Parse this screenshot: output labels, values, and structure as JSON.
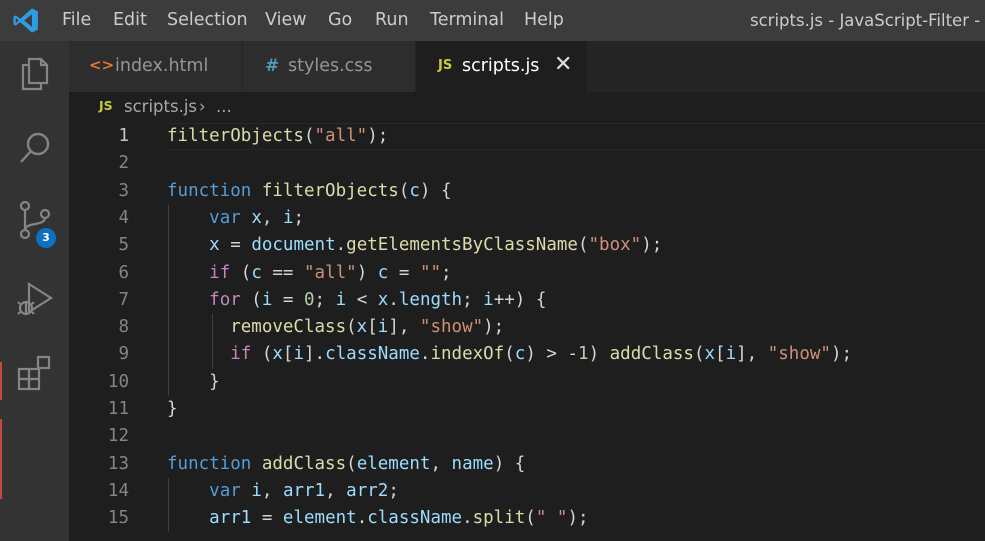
{
  "menu": [
    "File",
    "Edit",
    "Selection",
    "View",
    "Go",
    "Run",
    "Terminal",
    "Help"
  ],
  "window_title": "scripts.js - JavaScript-Filter - Vis",
  "activity_bar": {
    "items": [
      "explorer-icon",
      "search-icon",
      "source-control-icon",
      "run-debug-icon",
      "extensions-icon"
    ],
    "source_control_badge": "3"
  },
  "tabs": [
    {
      "icon_text": "<>",
      "icon_color": "#e37933",
      "label": "index.html",
      "active": false
    },
    {
      "icon_text": "#",
      "icon_color": "#519aba",
      "label": "styles.css",
      "active": false
    },
    {
      "icon_text": "JS",
      "icon_color": "#cbcb41",
      "label": "scripts.js",
      "active": true,
      "close": "✕"
    }
  ],
  "breadcrumb": {
    "icon_text": "JS",
    "file": "scripts.js",
    "separator": "›",
    "rest": "..."
  },
  "colors": {
    "keyword": "#569cd6",
    "control": "#c586c0",
    "function": "#dcdcaa",
    "variable": "#9cdcfe",
    "string": "#ce9178",
    "number": "#b5cea8",
    "plain": "#d4d4d4",
    "line_number": "#858585"
  },
  "code_lines": [
    {
      "n": "1",
      "tokens": [
        [
          "fn",
          "filterObjects"
        ],
        [
          "p",
          "("
        ],
        [
          "str",
          "\"all\""
        ],
        [
          "p",
          ");"
        ]
      ]
    },
    {
      "n": "2",
      "tokens": []
    },
    {
      "n": "3",
      "tokens": [
        [
          "kw",
          "function"
        ],
        [
          "p",
          " "
        ],
        [
          "fn",
          "filterObjects"
        ],
        [
          "p",
          "("
        ],
        [
          "var",
          "c"
        ],
        [
          "p",
          ") {"
        ]
      ]
    },
    {
      "n": "4",
      "tokens": [
        [
          "p",
          "    "
        ],
        [
          "kw",
          "var"
        ],
        [
          "p",
          " "
        ],
        [
          "var",
          "x"
        ],
        [
          "p",
          ", "
        ],
        [
          "var",
          "i"
        ],
        [
          "p",
          ";"
        ]
      ]
    },
    {
      "n": "5",
      "tokens": [
        [
          "p",
          "    "
        ],
        [
          "var",
          "x"
        ],
        [
          "p",
          " = "
        ],
        [
          "var",
          "document"
        ],
        [
          "p",
          "."
        ],
        [
          "fn",
          "getElementsByClassName"
        ],
        [
          "p",
          "("
        ],
        [
          "str",
          "\"box\""
        ],
        [
          "p",
          ");"
        ]
      ]
    },
    {
      "n": "6",
      "tokens": [
        [
          "p",
          "    "
        ],
        [
          "ctl",
          "if"
        ],
        [
          "p",
          " ("
        ],
        [
          "var",
          "c"
        ],
        [
          "p",
          " == "
        ],
        [
          "str",
          "\"all\""
        ],
        [
          "p",
          ") "
        ],
        [
          "var",
          "c"
        ],
        [
          "p",
          " = "
        ],
        [
          "str",
          "\"\""
        ],
        [
          "p",
          ";"
        ]
      ]
    },
    {
      "n": "7",
      "tokens": [
        [
          "p",
          "    "
        ],
        [
          "ctl",
          "for"
        ],
        [
          "p",
          " ("
        ],
        [
          "var",
          "i"
        ],
        [
          "p",
          " = "
        ],
        [
          "num",
          "0"
        ],
        [
          "p",
          "; "
        ],
        [
          "var",
          "i"
        ],
        [
          "p",
          " < "
        ],
        [
          "var",
          "x"
        ],
        [
          "p",
          "."
        ],
        [
          "var",
          "length"
        ],
        [
          "p",
          "; "
        ],
        [
          "var",
          "i"
        ],
        [
          "p",
          "++) {"
        ]
      ]
    },
    {
      "n": "8",
      "tokens": [
        [
          "p",
          "      "
        ],
        [
          "fn",
          "removeClass"
        ],
        [
          "p",
          "("
        ],
        [
          "var",
          "x"
        ],
        [
          "p",
          "["
        ],
        [
          "var",
          "i"
        ],
        [
          "p",
          "], "
        ],
        [
          "str",
          "\"show\""
        ],
        [
          "p",
          ");"
        ]
      ]
    },
    {
      "n": "9",
      "tokens": [
        [
          "p",
          "      "
        ],
        [
          "ctl",
          "if"
        ],
        [
          "p",
          " ("
        ],
        [
          "var",
          "x"
        ],
        [
          "p",
          "["
        ],
        [
          "var",
          "i"
        ],
        [
          "p",
          "]."
        ],
        [
          "var",
          "className"
        ],
        [
          "p",
          "."
        ],
        [
          "fn",
          "indexOf"
        ],
        [
          "p",
          "("
        ],
        [
          "var",
          "c"
        ],
        [
          "p",
          ") > -"
        ],
        [
          "num",
          "1"
        ],
        [
          "p",
          ") "
        ],
        [
          "fn",
          "addClass"
        ],
        [
          "p",
          "("
        ],
        [
          "var",
          "x"
        ],
        [
          "p",
          "["
        ],
        [
          "var",
          "i"
        ],
        [
          "p",
          "], "
        ],
        [
          "str",
          "\"show\""
        ],
        [
          "p",
          ");"
        ]
      ]
    },
    {
      "n": "10",
      "tokens": [
        [
          "p",
          "    }"
        ]
      ]
    },
    {
      "n": "11",
      "tokens": [
        [
          "p",
          "}"
        ]
      ]
    },
    {
      "n": "12",
      "tokens": []
    },
    {
      "n": "13",
      "tokens": [
        [
          "kw",
          "function"
        ],
        [
          "p",
          " "
        ],
        [
          "fn",
          "addClass"
        ],
        [
          "p",
          "("
        ],
        [
          "var",
          "element"
        ],
        [
          "p",
          ", "
        ],
        [
          "var",
          "name"
        ],
        [
          "p",
          ") {"
        ]
      ]
    },
    {
      "n": "14",
      "tokens": [
        [
          "p",
          "    "
        ],
        [
          "kw",
          "var"
        ],
        [
          "p",
          " "
        ],
        [
          "var",
          "i"
        ],
        [
          "p",
          ", "
        ],
        [
          "var",
          "arr1"
        ],
        [
          "p",
          ", "
        ],
        [
          "var",
          "arr2"
        ],
        [
          "p",
          ";"
        ]
      ]
    },
    {
      "n": "15",
      "tokens": [
        [
          "p",
          "    "
        ],
        [
          "var",
          "arr1"
        ],
        [
          "p",
          " = "
        ],
        [
          "var",
          "element"
        ],
        [
          "p",
          "."
        ],
        [
          "var",
          "className"
        ],
        [
          "p",
          "."
        ],
        [
          "fn",
          "split"
        ],
        [
          "p",
          "("
        ],
        [
          "str",
          "\" \""
        ],
        [
          "p",
          ");"
        ]
      ]
    }
  ]
}
